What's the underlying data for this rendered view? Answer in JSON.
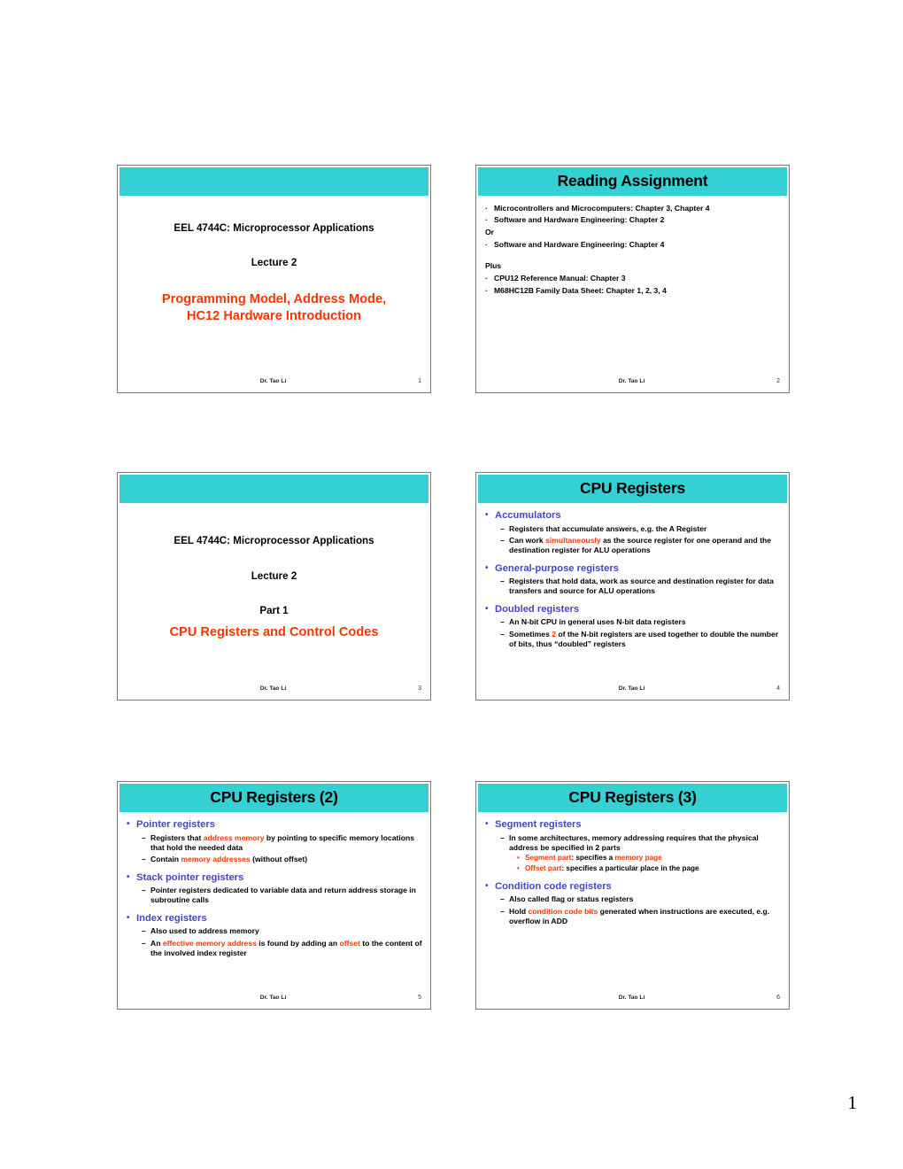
{
  "document": {
    "sheet_page_number": "1",
    "author_footer": "Dr. Tao Li",
    "colors": {
      "band": "#35d0d4",
      "heading": "#4545c4",
      "accent": "#ff3300"
    }
  },
  "slides": [
    {
      "kind": "title",
      "number": "1",
      "course": "EEL 4744C: Microprocessor Applications",
      "lecture": "Lecture 2",
      "topic_line1": "Programming Model, Address Mode,",
      "topic_line2": "HC12 Hardware Introduction",
      "footer_author": "Dr. Tao Li"
    },
    {
      "kind": "content",
      "number": "2",
      "title": "Reading Assignment",
      "footer_author": "Dr. Tao Li",
      "items": [
        {
          "level": "bullet",
          "bullet": "·",
          "text": "Microcontrollers and Microcomputers: Chapter 3, Chapter 4"
        },
        {
          "level": "bullet",
          "bullet": "·",
          "text": "Software and Hardware Engineering: Chapter 2"
        },
        {
          "level": "word",
          "text": "Or"
        },
        {
          "level": "bullet",
          "bullet": "·",
          "text": "Software and Hardware Engineering: Chapter 4"
        },
        {
          "level": "gap"
        },
        {
          "level": "word",
          "text": "Plus"
        },
        {
          "level": "bullet",
          "bullet": "·",
          "text": "CPU12 Reference Manual: Chapter 3"
        },
        {
          "level": "bullet",
          "bullet": "·",
          "text": "M68HC12B Family Data Sheet: Chapter 1, 2, 3, 4"
        }
      ]
    },
    {
      "kind": "title",
      "number": "3",
      "course": "EEL 4744C: Microprocessor Applications",
      "lecture": "Lecture 2",
      "part": "Part 1",
      "topic_line1": "CPU Registers and Control Codes",
      "footer_author": "Dr. Tao Li"
    },
    {
      "kind": "content",
      "number": "4",
      "title": "CPU Registers",
      "footer_author": "Dr. Tao Li",
      "items": [
        {
          "level": "1",
          "bullet": "•",
          "text": "Accumulators"
        },
        {
          "level": "2",
          "bullet": "–",
          "runs": [
            {
              "t": "Registers that accumulate answers, e.g. the A Register"
            }
          ]
        },
        {
          "level": "2",
          "bullet": "–",
          "runs": [
            {
              "t": "Can work "
            },
            {
              "t": "simultaneously",
              "c": "red"
            },
            {
              "t": " as the source register for one operand and the destination register for ALU operations"
            }
          ]
        },
        {
          "level": "1",
          "bullet": "•",
          "text": "General-purpose registers"
        },
        {
          "level": "2",
          "bullet": "–",
          "runs": [
            {
              "t": "Registers that hold data, work as source and destination register for data transfers and source for ALU operations"
            }
          ]
        },
        {
          "level": "1",
          "bullet": "•",
          "text": "Doubled registers"
        },
        {
          "level": "2",
          "bullet": "–",
          "runs": [
            {
              "t": "An N-bit CPU in general uses N-bit data registers"
            }
          ]
        },
        {
          "level": "2",
          "bullet": "–",
          "runs": [
            {
              "t": "Sometimes "
            },
            {
              "t": "2",
              "c": "red"
            },
            {
              "t": " of the N-bit registers are used together to double the number of bits, thus “doubled” registers"
            }
          ]
        }
      ]
    },
    {
      "kind": "content",
      "number": "5",
      "title": "CPU Registers (2)",
      "footer_author": "Dr. Tao Li",
      "items": [
        {
          "level": "1",
          "bullet": "•",
          "text": "Pointer registers"
        },
        {
          "level": "2",
          "bullet": "–",
          "runs": [
            {
              "t": "Registers that "
            },
            {
              "t": "address memory",
              "c": "red"
            },
            {
              "t": " by pointing to specific memory locations that hold the needed data"
            }
          ]
        },
        {
          "level": "2",
          "bullet": "–",
          "runs": [
            {
              "t": "Contain "
            },
            {
              "t": "memory addresses",
              "c": "red"
            },
            {
              "t": " (without offset)"
            }
          ]
        },
        {
          "level": "1",
          "bullet": "•",
          "text": "Stack pointer registers"
        },
        {
          "level": "2",
          "bullet": "–",
          "runs": [
            {
              "t": "Pointer registers dedicated to variable data and return address storage in subroutine calls"
            }
          ]
        },
        {
          "level": "1",
          "bullet": "•",
          "text": "Index registers"
        },
        {
          "level": "2",
          "bullet": "–",
          "runs": [
            {
              "t": "Also used to address memory"
            }
          ]
        },
        {
          "level": "2",
          "bullet": "–",
          "runs": [
            {
              "t": "An "
            },
            {
              "t": "effective memory address",
              "c": "red"
            },
            {
              "t": " is found by adding an "
            },
            {
              "t": "offset",
              "c": "red"
            },
            {
              "t": " to the content of the involved index register"
            }
          ]
        }
      ]
    },
    {
      "kind": "content",
      "number": "6",
      "title": "CPU Registers (3)",
      "footer_author": "Dr. Tao Li",
      "items": [
        {
          "level": "1",
          "bullet": "•",
          "text": "Segment registers"
        },
        {
          "level": "2",
          "bullet": "–",
          "runs": [
            {
              "t": "In some architectures, memory addressing requires that the physical address be specified in 2 parts"
            }
          ]
        },
        {
          "level": "3",
          "bullet": "•",
          "runs": [
            {
              "t": "Segment part",
              "c": "red"
            },
            {
              "t": ": specifies a "
            },
            {
              "t": "memory page",
              "c": "red"
            }
          ]
        },
        {
          "level": "3",
          "bullet": "•",
          "runs": [
            {
              "t": "Offset part",
              "c": "red"
            },
            {
              "t": ": specifies a particular place in the page"
            }
          ]
        },
        {
          "level": "1",
          "bullet": "•",
          "text": "Condition code registers"
        },
        {
          "level": "2",
          "bullet": "–",
          "runs": [
            {
              "t": "Also called flag or status registers"
            }
          ]
        },
        {
          "level": "2",
          "bullet": "–",
          "runs": [
            {
              "t": "Hold "
            },
            {
              "t": "condition code bits",
              "c": "red"
            },
            {
              "t": " generated when instructions are executed, e.g. overflow in ADD"
            }
          ]
        }
      ]
    }
  ]
}
